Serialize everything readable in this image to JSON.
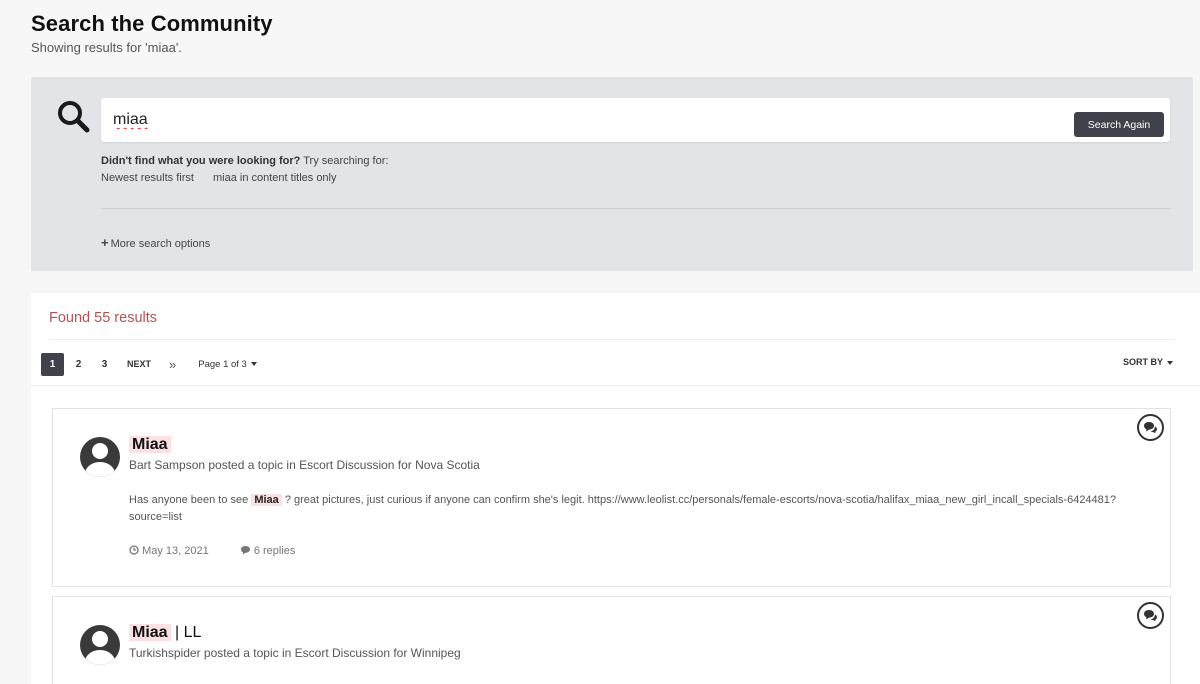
{
  "header": {
    "title": "Search the Community",
    "subtitle": "Showing results for 'miaa'."
  },
  "search": {
    "value": "miaa",
    "button_label": "Search Again",
    "suggest_prefix": "Didn't find what you were looking for?",
    "suggest_suffix": " Try searching for:",
    "suggest_links": [
      "Newest results first",
      "miaa in content titles only"
    ],
    "more_options_label": "More search options"
  },
  "results": {
    "found_label": "Found 55 results",
    "pagination": {
      "pages": [
        "1",
        "2",
        "3"
      ],
      "active_page": "1",
      "next_label": "NEXT",
      "last_label": "»",
      "page_of": "Page 1 of 3"
    },
    "sort_label": "SORT BY",
    "items": [
      {
        "title_highlight": "Miaa",
        "title_rest": "",
        "meta": "Bart Sampson posted a topic in Escort Discussion for Nova Scotia",
        "snippet_before": "Has anyone been to see ",
        "snippet_highlight": "Miaa",
        "snippet_after": " ? great pictures, just curious if anyone can confirm she's legit. https://www.leolist.cc/personals/female-escorts/nova-scotia/halifax_miaa_new_girl_incall_specials-6424481?source=list",
        "date": "May 13, 2021",
        "replies": "6 replies"
      },
      {
        "title_highlight": "Miaa",
        "title_rest": " | LL",
        "meta": "Turkishspider posted a topic in Escort Discussion for Winnipeg"
      }
    ]
  }
}
